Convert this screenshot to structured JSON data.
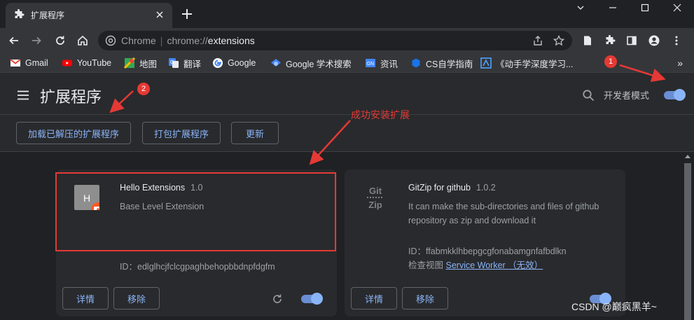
{
  "tab": {
    "title": "扩展程序"
  },
  "toolbar": {
    "omnibox_site": "Chrome",
    "omnibox_scheme": "chrome://",
    "omnibox_host": "extensions"
  },
  "bookmarks": [
    {
      "label": "Gmail",
      "icon": "gmail-icon"
    },
    {
      "label": "YouTube",
      "icon": "youtube-icon"
    },
    {
      "label": "地图",
      "icon": "maps-icon"
    },
    {
      "label": "翻译",
      "icon": "translate-icon"
    },
    {
      "label": "Google",
      "icon": "google-icon"
    },
    {
      "label": "Google 学术搜索",
      "icon": "scholar-icon"
    },
    {
      "label": "资讯",
      "icon": "news-icon"
    },
    {
      "label": "CS自学指南",
      "icon": "cs-guide-icon"
    },
    {
      "label": "《动手学深度学习...",
      "icon": "d2l-icon"
    }
  ],
  "bookmarks_more": "»",
  "page": {
    "title": "扩展程序",
    "dev_mode_label": "开发者模式",
    "dev_mode_on": true,
    "actions": {
      "load_unpacked": "加载已解压的扩展程序",
      "pack": "打包扩展程序",
      "update": "更新"
    }
  },
  "extensions": [
    {
      "name": "Hello Extensions",
      "version": "1.0",
      "description": "Base Level Extension",
      "id_label": "ID：",
      "id": "edlglhcjfclcgpaghbehopbbdnpfdgfm",
      "details_label": "详情",
      "remove_label": "移除",
      "enabled": true,
      "icon_letter": "H"
    },
    {
      "name": "GitZip for github",
      "version": "1.0.2",
      "description": "It can make the sub-directories and files of github repository as zip and download it",
      "id_label": "ID：",
      "id": "ffabmkklhbepgcgfonabamgnfafbdlkn",
      "inspect_label": "检查视图",
      "inspect_link": "Service Worker （无效）",
      "details_label": "详情",
      "remove_label": "移除",
      "enabled": true,
      "icon_text_top": "Git",
      "icon_text_bottom": "Zip"
    }
  ],
  "annotations": {
    "badge_1": "1",
    "badge_2": "2",
    "success_text": "成功安装扩展"
  },
  "watermark": "CSDN @巅疯黑羊~",
  "colors": {
    "accent": "#8ab4f8",
    "annotation_red": "#e53935",
    "background": "#202124",
    "surface": "#292a2d"
  }
}
